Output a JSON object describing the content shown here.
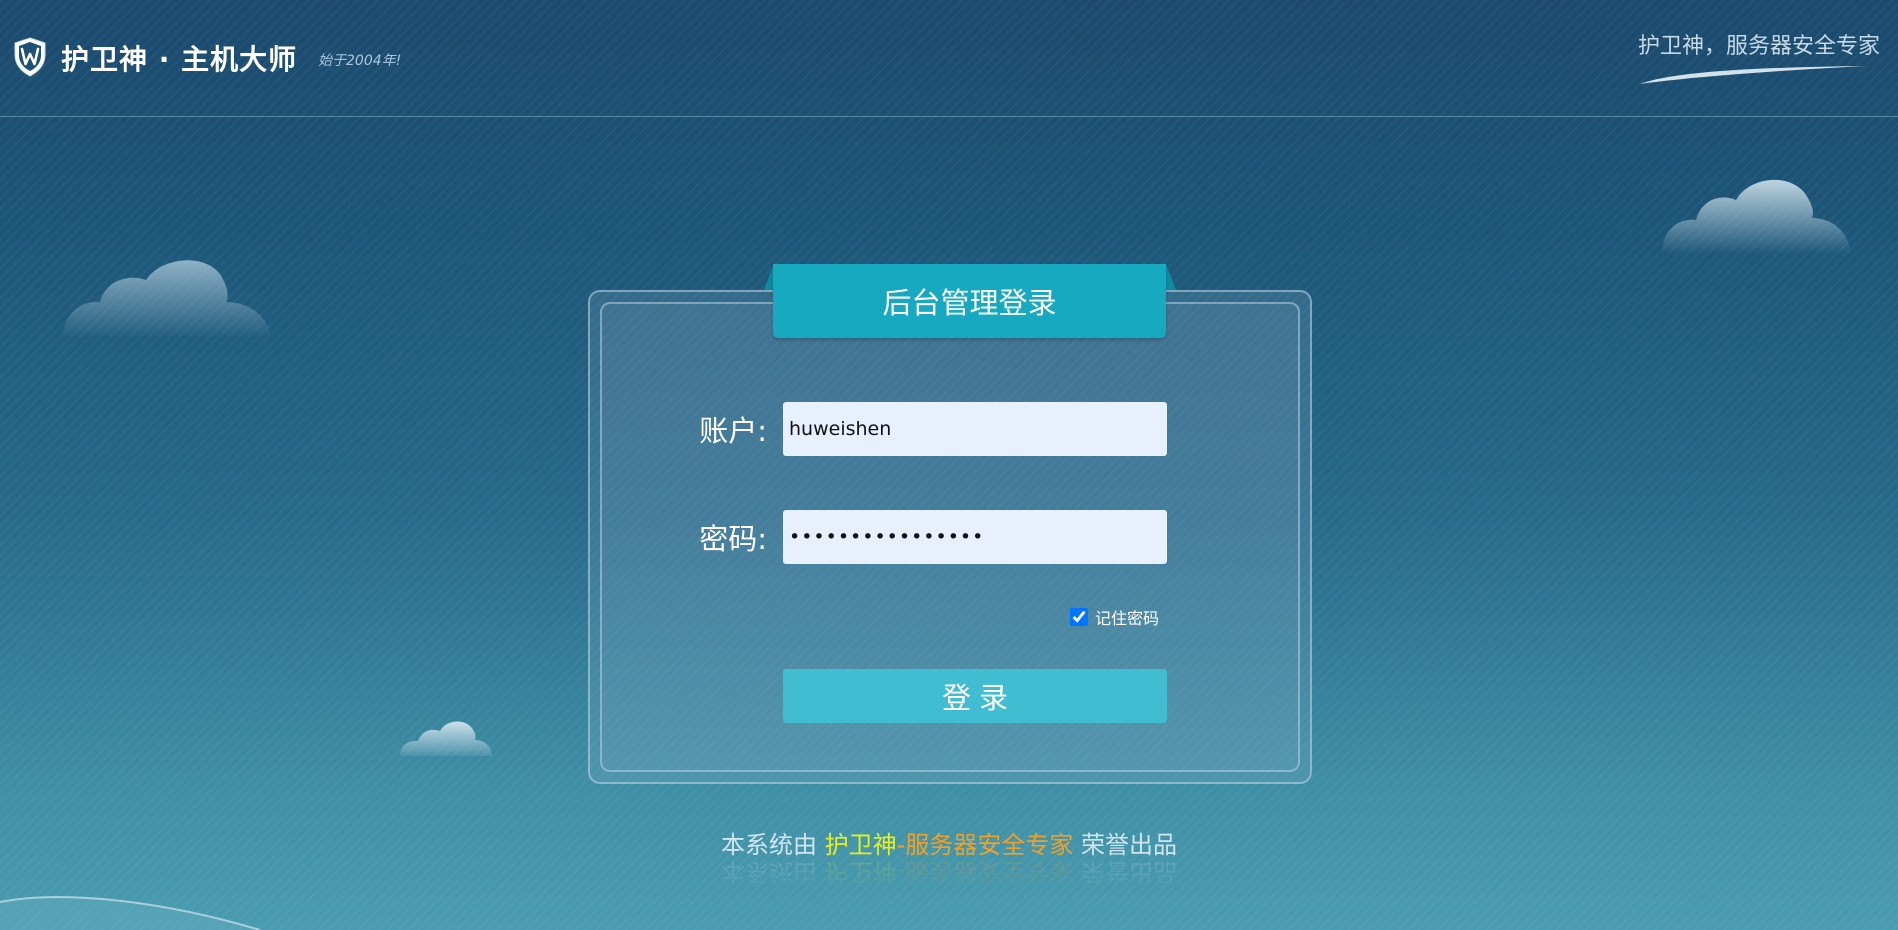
{
  "header": {
    "brand": "护卫神 · 主机大师",
    "since": "始于2004年!",
    "slogan": "护卫神，服务器安全专家"
  },
  "login": {
    "title": "后台管理登录",
    "account_label": "账户:",
    "account_value": "huweishen",
    "password_label": "密码:",
    "password_value": "••••••••••••••••",
    "remember_label": "记住密码",
    "remember_checked": true,
    "submit_label": "登录"
  },
  "footer": {
    "part1": "本系统由 ",
    "part2": "护卫神",
    "part3": "-服务器安全专家",
    "part4": " 荣誉出品"
  },
  "icons": {
    "logo": "shield-w-icon",
    "clouds": "cloud-icon"
  },
  "colors": {
    "ribbon": "#16a9c0",
    "button": "#40bdd0",
    "brand_yellow": "#e8f01a",
    "brand_orange": "#f1a126"
  }
}
